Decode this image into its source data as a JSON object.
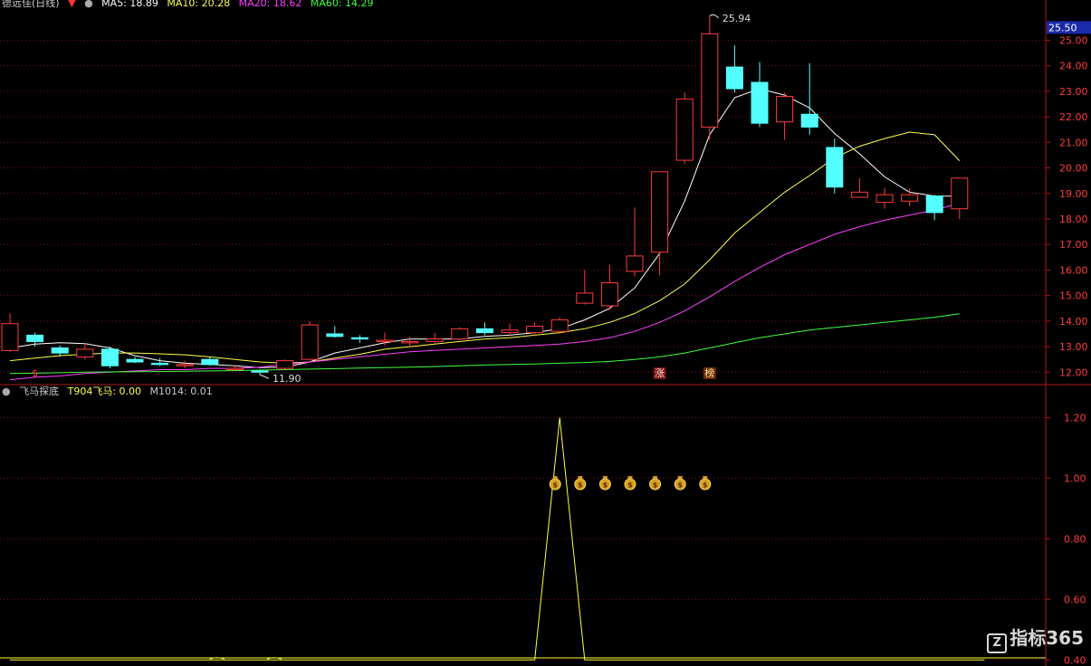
{
  "header": {
    "title": "德远佳(日线)",
    "ma5": "MA5: 18.89",
    "ma10": "MA10: 20.28",
    "ma20": "MA20: 18.62",
    "ma60": "MA60: 14.29"
  },
  "indicator_header": {
    "name": "飞马探底",
    "t904": "T904飞马: 0.00",
    "m1014": "M1014: 0.01"
  },
  "watermark": "指标365",
  "colors": {
    "background": "#000000",
    "up": "#ff3c3c",
    "down": "#54ffff",
    "grid": "#7a1010",
    "axis": "#b01818",
    "ma5": "#ffffff",
    "ma10": "#ffff4c",
    "ma20": "#ff40ff",
    "ma60": "#40ff40",
    "indicator_line": "#ffff3c"
  },
  "chart_data": [
    {
      "type": "candlestick",
      "ylim": [
        11.55,
        26.15
      ],
      "yticks": [
        "12.00",
        "13.00",
        "14.00",
        "15.00",
        "16.00",
        "17.00",
        "18.00",
        "19.00",
        "20.00",
        "21.00",
        "22.00",
        "23.00",
        "24.00",
        "25.00"
      ],
      "price_tag": "25.50",
      "annotations": {
        "high": "25.94",
        "low": "11.90"
      },
      "markers": [
        "$",
        "涨",
        "榜"
      ],
      "candles": [
        {
          "o": 12.85,
          "h": 14.3,
          "l": 12.8,
          "c": 13.9
        },
        {
          "o": 13.45,
          "h": 13.55,
          "l": 13.0,
          "c": 13.2
        },
        {
          "o": 12.95,
          "h": 13.05,
          "l": 12.6,
          "c": 12.75
        },
        {
          "o": 12.6,
          "h": 13.15,
          "l": 12.5,
          "c": 12.9
        },
        {
          "o": 12.9,
          "h": 13.0,
          "l": 12.15,
          "c": 12.25
        },
        {
          "o": 12.5,
          "h": 12.6,
          "l": 12.35,
          "c": 12.4
        },
        {
          "o": 12.35,
          "h": 12.55,
          "l": 12.25,
          "c": 12.3
        },
        {
          "o": 12.25,
          "h": 12.45,
          "l": 12.15,
          "c": 12.3
        },
        {
          "o": 12.5,
          "h": 12.6,
          "l": 12.25,
          "c": 12.3
        },
        {
          "o": 12.1,
          "h": 12.3,
          "l": 12.05,
          "c": 12.15
        },
        {
          "o": 12.05,
          "h": 12.1,
          "l": 11.9,
          "c": 12.0
        },
        {
          "o": 12.15,
          "h": 12.5,
          "l": 12.1,
          "c": 12.45
        },
        {
          "o": 12.5,
          "h": 14.0,
          "l": 12.45,
          "c": 13.85
        },
        {
          "o": 13.5,
          "h": 13.8,
          "l": 13.35,
          "c": 13.4
        },
        {
          "o": 13.35,
          "h": 13.45,
          "l": 13.15,
          "c": 13.3
        },
        {
          "o": 13.2,
          "h": 13.55,
          "l": 13.05,
          "c": 13.25
        },
        {
          "o": 13.15,
          "h": 13.4,
          "l": 13.0,
          "c": 13.2
        },
        {
          "o": 13.2,
          "h": 13.55,
          "l": 13.1,
          "c": 13.3
        },
        {
          "o": 13.3,
          "h": 13.75,
          "l": 13.25,
          "c": 13.7
        },
        {
          "o": 13.7,
          "h": 13.95,
          "l": 13.45,
          "c": 13.55
        },
        {
          "o": 13.55,
          "h": 13.9,
          "l": 13.4,
          "c": 13.65
        },
        {
          "o": 13.55,
          "h": 13.95,
          "l": 13.4,
          "c": 13.8
        },
        {
          "o": 13.6,
          "h": 14.15,
          "l": 13.5,
          "c": 14.05
        },
        {
          "o": 14.7,
          "h": 16.0,
          "l": 14.65,
          "c": 15.1
        },
        {
          "o": 14.6,
          "h": 16.2,
          "l": 14.45,
          "c": 15.5
        },
        {
          "o": 15.95,
          "h": 18.45,
          "l": 15.75,
          "c": 16.55
        },
        {
          "o": 16.7,
          "h": 19.85,
          "l": 15.8,
          "c": 19.85
        },
        {
          "o": 20.3,
          "h": 22.95,
          "l": 20.15,
          "c": 22.7
        },
        {
          "o": 21.6,
          "h": 25.94,
          "l": 21.1,
          "c": 25.25
        },
        {
          "o": 23.95,
          "h": 24.8,
          "l": 22.95,
          "c": 23.1
        },
        {
          "o": 23.35,
          "h": 24.15,
          "l": 21.6,
          "c": 21.75
        },
        {
          "o": 21.8,
          "h": 22.95,
          "l": 21.1,
          "c": 22.8
        },
        {
          "o": 22.1,
          "h": 24.1,
          "l": 21.3,
          "c": 21.6
        },
        {
          "o": 20.8,
          "h": 21.15,
          "l": 19.0,
          "c": 19.25
        },
        {
          "o": 18.85,
          "h": 19.6,
          "l": 18.85,
          "c": 19.05
        },
        {
          "o": 18.65,
          "h": 19.2,
          "l": 18.4,
          "c": 18.95
        },
        {
          "o": 18.7,
          "h": 19.2,
          "l": 18.5,
          "c": 18.95
        },
        {
          "o": 18.9,
          "h": 18.95,
          "l": 17.95,
          "c": 18.25
        },
        {
          "o": 18.4,
          "h": 19.55,
          "l": 18.0,
          "c": 19.6
        }
      ],
      "series": [
        {
          "name": "MA5",
          "values": [
            12.95,
            13.1,
            13.15,
            13.12,
            12.95,
            12.65,
            12.45,
            12.35,
            12.3,
            12.25,
            12.18,
            12.2,
            12.4,
            12.75,
            12.95,
            13.15,
            13.3,
            13.3,
            13.3,
            13.4,
            13.45,
            13.55,
            13.7,
            14.05,
            14.5,
            15.3,
            16.65,
            18.7,
            21.3,
            22.75,
            23.1,
            22.85,
            22.35,
            21.35,
            20.55,
            19.65,
            19.05,
            18.9,
            18.89
          ]
        },
        {
          "name": "MA10",
          "values": [
            12.45,
            12.55,
            12.65,
            12.7,
            12.75,
            12.75,
            12.72,
            12.68,
            12.6,
            12.5,
            12.4,
            12.35,
            12.4,
            12.55,
            12.7,
            12.9,
            13.0,
            13.1,
            13.2,
            13.3,
            13.35,
            13.45,
            13.55,
            13.7,
            13.95,
            14.3,
            14.8,
            15.45,
            16.4,
            17.45,
            18.25,
            19.05,
            19.7,
            20.4,
            20.85,
            21.15,
            21.4,
            21.3,
            20.28
          ]
        },
        {
          "name": "MA20",
          "values": [
            11.7,
            11.8,
            11.85,
            11.95,
            12.0,
            12.05,
            12.1,
            12.1,
            12.15,
            12.15,
            12.2,
            12.3,
            12.4,
            12.5,
            12.6,
            12.7,
            12.8,
            12.85,
            12.9,
            12.95,
            13.0,
            13.05,
            13.1,
            13.2,
            13.35,
            13.6,
            13.95,
            14.4,
            14.95,
            15.55,
            16.1,
            16.6,
            17.0,
            17.4,
            17.7,
            17.95,
            18.15,
            18.35,
            18.62
          ]
        },
        {
          "name": "MA60",
          "values": [
            11.95,
            11.96,
            11.98,
            12.0,
            12.01,
            12.02,
            12.03,
            12.04,
            12.05,
            12.06,
            12.08,
            12.1,
            12.12,
            12.14,
            12.16,
            12.18,
            12.2,
            12.22,
            12.25,
            12.28,
            12.3,
            12.32,
            12.35,
            12.38,
            12.42,
            12.5,
            12.6,
            12.75,
            12.95,
            13.15,
            13.35,
            13.5,
            13.65,
            13.75,
            13.85,
            13.95,
            14.05,
            14.15,
            14.29
          ]
        }
      ]
    },
    {
      "type": "line",
      "ylim": [
        0.38,
        1.3
      ],
      "yticks": [
        "0.40",
        "0.60",
        "0.80",
        "1.00",
        "1.20"
      ],
      "series": [
        {
          "values": [
            0.4,
            0.4,
            0.4,
            0.4,
            0.4,
            0.4,
            0.4,
            0.4,
            0.4,
            0.4,
            0.4,
            0.4,
            0.4,
            0.4,
            0.4,
            0.4,
            0.4,
            0.4,
            0.4,
            0.4,
            0.4,
            0.4,
            1.2,
            0.4,
            0.4,
            0.4,
            0.4,
            0.4,
            0.4,
            0.4,
            0.4,
            0.4,
            0.4,
            0.4,
            0.4,
            0.4,
            0.4,
            0.4,
            0.4,
            0.4
          ]
        }
      ],
      "signals": [
        22,
        23,
        24,
        25,
        26,
        27,
        28
      ],
      "signal_value": 0.98,
      "signal_icon": "money-bag-icon"
    }
  ]
}
